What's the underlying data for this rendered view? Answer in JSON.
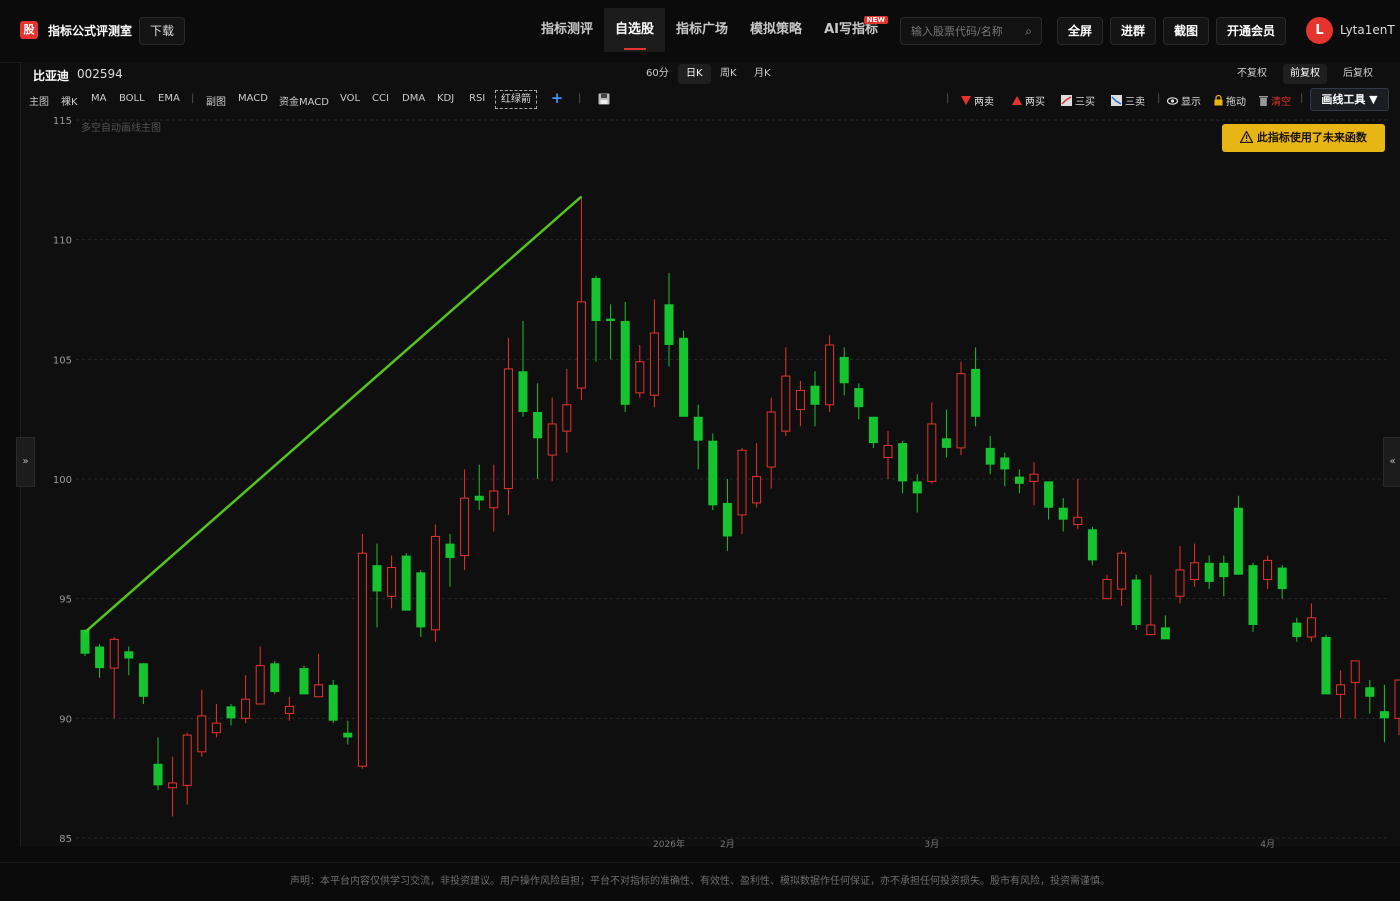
{
  "app": {
    "logo_char": "股",
    "title": "指标公式评测室",
    "download_label": "下载"
  },
  "nav": [
    {
      "label": "指标测评"
    },
    {
      "label": "自选股",
      "active": true
    },
    {
      "label": "指标广场"
    },
    {
      "label": "模拟策略"
    },
    {
      "label": "AI写指标",
      "badge": "NEW"
    }
  ],
  "search": {
    "placeholder": "输入股票代码/名称"
  },
  "toolbar": {
    "fullscreen": "全屏",
    "join_group": "进群",
    "screenshot": "截图",
    "vip": "开通会员"
  },
  "user": {
    "avatar_letter": "L",
    "name": "Lyta1enT"
  },
  "stock": {
    "name": "比亚迪",
    "code": "002594"
  },
  "periods": [
    {
      "label": "60分"
    },
    {
      "label": "日K",
      "active": true
    },
    {
      "label": "周K"
    },
    {
      "label": "月K"
    }
  ],
  "adjust": [
    {
      "label": "不复权"
    },
    {
      "label": "前复权",
      "active": true
    },
    {
      "label": "后复权"
    }
  ],
  "indicators": {
    "main": [
      "主图",
      "裸K",
      "MA",
      "BOLL",
      "EMA"
    ],
    "sub": [
      "副图",
      "MACD",
      "资金MACD",
      "VOL",
      "CCI",
      "DMA",
      "KDJ",
      "RSI"
    ],
    "red_green_arrow": "红绿箭",
    "add": "+"
  },
  "draw_tools": {
    "two_sell": "两卖",
    "two_buy": "两买",
    "three_buy": "三买",
    "three_sell": "三卖",
    "show": "显示",
    "drag": "拖动",
    "clear": "清空",
    "menu": "画线工具 ▼"
  },
  "warning": "此指标使用了未来函数",
  "chart_caption": "多空自动画线主图",
  "footer": "声明：本平台内容仅供学习交流，非投资建议。用户操作风险自担；平台不对指标的准确性、有效性、盈利性、模拟数据作任何保证，亦不承担任何投资损失。股市有风险，投资需谨慎。",
  "colors": {
    "up": "#e5332d",
    "down": "#16c42f",
    "trendline": "#56c41e",
    "warning_bg": "#e7b514"
  },
  "chart_data": {
    "type": "candlestick",
    "ylim": [
      85,
      115
    ],
    "yticks": [
      85,
      90,
      95,
      100,
      105,
      110,
      115
    ],
    "xlabels": [
      "2026年",
      "2月",
      "3月",
      "4月"
    ],
    "candles": [
      [
        93.7,
        92.7,
        93.7,
        92.6
      ],
      [
        93.0,
        92.1,
        93.1,
        91.7
      ],
      [
        92.1,
        93.3,
        93.4,
        90.0
      ],
      [
        92.8,
        92.5,
        93.0,
        91.8
      ],
      [
        92.3,
        90.9,
        92.3,
        90.6
      ],
      [
        88.1,
        87.2,
        89.2,
        87.0
      ],
      [
        87.1,
        87.3,
        88.4,
        85.9
      ],
      [
        87.2,
        89.3,
        89.4,
        86.4
      ],
      [
        88.6,
        90.1,
        91.2,
        88.4
      ],
      [
        89.4,
        89.8,
        90.6,
        89.2
      ],
      [
        90.5,
        90.0,
        90.6,
        89.7
      ],
      [
        90.0,
        90.8,
        91.8,
        89.8
      ],
      [
        90.6,
        92.2,
        93.0,
        90.7
      ],
      [
        92.3,
        91.1,
        92.4,
        91.0
      ],
      [
        90.2,
        90.5,
        90.9,
        89.9
      ],
      [
        92.1,
        91.0,
        92.2,
        91.0
      ],
      [
        90.9,
        91.4,
        92.7,
        91.1
      ],
      [
        91.4,
        89.9,
        91.6,
        89.8
      ],
      [
        89.4,
        89.2,
        89.9,
        88.9
      ],
      [
        88.0,
        96.9,
        97.7,
        87.9
      ],
      [
        96.4,
        95.3,
        97.3,
        93.8
      ],
      [
        95.1,
        96.3,
        96.8,
        94.6
      ],
      [
        96.8,
        94.5,
        96.9,
        94.5
      ],
      [
        96.1,
        93.8,
        96.2,
        93.4
      ],
      [
        93.7,
        97.6,
        98.1,
        93.2
      ],
      [
        97.3,
        96.7,
        97.7,
        95.5
      ],
      [
        96.8,
        99.2,
        100.4,
        96.2
      ],
      [
        99.3,
        99.1,
        100.6,
        98.7
      ],
      [
        98.8,
        99.5,
        100.6,
        97.8
      ],
      [
        99.6,
        104.6,
        105.9,
        98.5
      ],
      [
        104.5,
        102.8,
        106.6,
        102.6
      ],
      [
        102.8,
        101.7,
        104.0,
        100.0
      ],
      [
        101.0,
        102.3,
        103.4,
        99.9
      ],
      [
        102.0,
        103.1,
        104.6,
        101.1
      ],
      [
        103.8,
        107.4,
        111.8,
        103.3
      ],
      [
        108.4,
        106.6,
        108.5,
        104.9
      ],
      [
        106.7,
        106.6,
        107.3,
        105.0
      ],
      [
        106.6,
        103.1,
        107.4,
        102.8
      ],
      [
        103.6,
        104.9,
        105.6,
        103.4
      ],
      [
        103.5,
        106.1,
        107.5,
        103.0
      ],
      [
        107.3,
        105.6,
        108.6,
        104.7
      ],
      [
        105.9,
        102.6,
        106.2,
        102.6
      ],
      [
        102.6,
        101.6,
        103.1,
        100.4
      ],
      [
        101.6,
        98.9,
        101.9,
        98.7
      ],
      [
        99.0,
        97.6,
        100.0,
        97.0
      ],
      [
        98.5,
        101.2,
        101.3,
        97.7
      ],
      [
        99.0,
        100.1,
        101.5,
        98.8
      ],
      [
        100.5,
        102.8,
        103.4,
        99.6
      ],
      [
        102.0,
        104.3,
        105.5,
        101.8
      ],
      [
        102.9,
        103.7,
        104.1,
        102.2
      ],
      [
        103.9,
        103.1,
        104.5,
        102.2
      ],
      [
        103.1,
        105.6,
        106.0,
        102.8
      ],
      [
        105.1,
        104.0,
        105.5,
        103.5
      ],
      [
        103.8,
        103.0,
        104.0,
        102.5
      ],
      [
        102.6,
        101.5,
        102.6,
        101.3
      ],
      [
        100.9,
        101.4,
        102.0,
        100.0
      ],
      [
        101.5,
        99.9,
        101.6,
        99.4
      ],
      [
        99.9,
        99.4,
        100.2,
        98.6
      ],
      [
        99.9,
        102.3,
        103.2,
        99.8
      ],
      [
        101.7,
        101.3,
        102.9,
        100.9
      ],
      [
        101.3,
        104.4,
        104.9,
        101.0
      ],
      [
        104.6,
        102.6,
        105.5,
        102.2
      ],
      [
        101.3,
        100.6,
        101.8,
        100.2
      ],
      [
        100.9,
        100.4,
        101.1,
        99.7
      ],
      [
        100.1,
        99.8,
        100.4,
        99.4
      ],
      [
        99.9,
        100.2,
        100.7,
        98.9
      ],
      [
        99.9,
        98.8,
        99.9,
        98.3
      ],
      [
        98.8,
        98.3,
        99.2,
        97.8
      ],
      [
        98.1,
        98.4,
        100.0,
        97.9
      ],
      [
        97.9,
        96.6,
        98.0,
        96.4
      ],
      [
        95.0,
        95.8,
        96.0,
        95.0
      ],
      [
        95.4,
        96.9,
        97.0,
        94.7
      ],
      [
        95.8,
        93.9,
        96.0,
        93.7
      ],
      [
        93.5,
        93.9,
        96.0,
        93.5
      ],
      [
        93.8,
        93.3,
        94.3,
        93.7
      ],
      [
        95.1,
        96.2,
        97.2,
        94.8
      ],
      [
        95.8,
        96.5,
        97.3,
        95.5
      ],
      [
        96.5,
        95.7,
        96.8,
        95.4
      ],
      [
        96.5,
        95.9,
        96.8,
        95.1
      ],
      [
        98.8,
        96.0,
        99.3,
        96.0
      ],
      [
        96.4,
        93.9,
        96.5,
        93.6
      ],
      [
        95.8,
        96.6,
        96.8,
        95.4
      ],
      [
        96.3,
        95.4,
        96.4,
        95.0
      ],
      [
        94.0,
        93.4,
        94.2,
        93.2
      ],
      [
        93.4,
        94.2,
        94.8,
        93.2
      ],
      [
        93.4,
        91.0,
        93.5,
        92.4
      ],
      [
        91.0,
        91.4,
        92.0,
        90.0
      ],
      [
        91.5,
        92.4,
        92.0,
        90.0
      ],
      [
        91.3,
        90.9,
        91.6,
        90.2
      ],
      [
        90.3,
        90.0,
        91.4,
        89.0
      ],
      [
        90.0,
        91.6,
        91.6,
        89.3
      ]
    ],
    "trendline": {
      "from": [
        0,
        93.6
      ],
      "to": [
        34,
        111.8
      ]
    }
  }
}
